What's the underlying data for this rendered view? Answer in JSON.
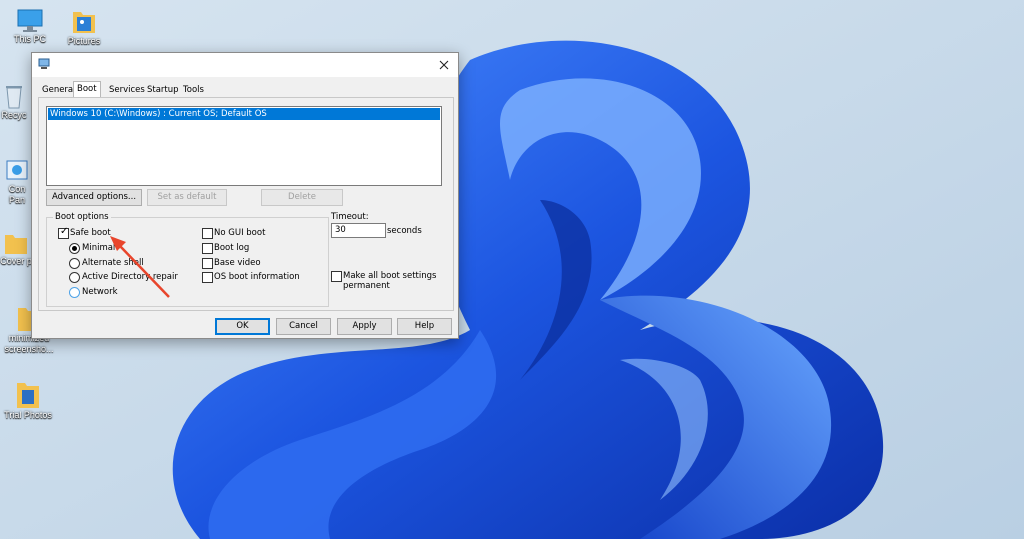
{
  "desktop": {
    "icons": [
      {
        "label": "This PC",
        "icon": "this-pc-icon"
      },
      {
        "label": "Pictures",
        "icon": "pictures-folder-icon"
      },
      {
        "label": "Recyc",
        "icon": "recycle-bin-icon"
      },
      {
        "label": "Con\nPan",
        "icon": "control-panel-icon"
      },
      {
        "label": "Cover p",
        "icon": "folder-icon"
      },
      {
        "label": "minimized\nscreensho...",
        "icon": "folder-icon"
      },
      {
        "label": "Trial Photos",
        "icon": "folder-icon"
      }
    ]
  },
  "dialog": {
    "tabs": [
      "General",
      "Boot",
      "Services",
      "Startup",
      "Tools"
    ],
    "active_tab": "Boot",
    "os_entries": [
      "Windows 10 (C:\\Windows) : Current OS; Default OS"
    ],
    "buttons": {
      "advanced": "Advanced options...",
      "set_default": "Set as default",
      "delete": "Delete",
      "ok": "OK",
      "cancel": "Cancel",
      "apply": "Apply",
      "help": "Help"
    },
    "boot_options": {
      "legend": "Boot options",
      "safe_boot": {
        "label": "Safe boot",
        "checked": true
      },
      "radios": [
        {
          "label": "Minimal",
          "selected": true
        },
        {
          "label": "Alternate shell",
          "selected": false
        },
        {
          "label": "Active Directory repair",
          "selected": false
        },
        {
          "label": "Network",
          "selected": false
        }
      ],
      "right_checks": [
        "No GUI boot",
        "Boot log",
        "Base video",
        "OS boot information"
      ]
    },
    "timeout": {
      "label": "Timeout:",
      "value": "30",
      "unit": "seconds"
    },
    "make_permanent": {
      "line1": "Make all boot settings",
      "line2": "permanent"
    }
  },
  "colors": {
    "selection": "#0078d7",
    "arrow": "#e8452c",
    "desktop_bg": "#c9dcec",
    "ribbon": "#1f5fe6"
  }
}
